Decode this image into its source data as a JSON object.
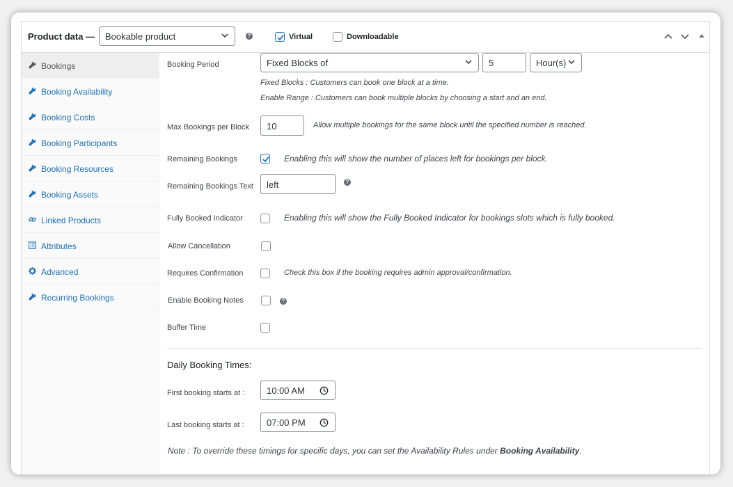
{
  "header": {
    "title": "Product data —",
    "product_type": "Bookable product",
    "virtual_label": "Virtual",
    "virtual_checked": true,
    "downloadable_label": "Downloadable",
    "downloadable_checked": false
  },
  "sidebar": {
    "items": [
      {
        "label": "Bookings",
        "icon": "wrench-icon",
        "active": true
      },
      {
        "label": "Booking Availability",
        "icon": "wrench-icon"
      },
      {
        "label": "Booking Costs",
        "icon": "wrench-icon"
      },
      {
        "label": "Booking Participants",
        "icon": "wrench-icon"
      },
      {
        "label": "Booking Resources",
        "icon": "wrench-icon"
      },
      {
        "label": "Booking Assets",
        "icon": "wrench-icon"
      },
      {
        "label": "Linked Products",
        "icon": "link-icon"
      },
      {
        "label": "Attributes",
        "icon": "list-icon"
      },
      {
        "label": "Advanced",
        "icon": "gear-icon"
      },
      {
        "label": "Recurring Bookings",
        "icon": "wrench-icon"
      }
    ]
  },
  "main": {
    "booking_period": {
      "label": "Booking Period",
      "type_value": "Fixed Blocks of",
      "count_value": "5",
      "unit_value": "Hour(s)",
      "desc1": "Fixed Blocks : Customers can book one block at a time.",
      "desc2": "Enable Range : Customers can book multiple blocks by choosing a start and an end."
    },
    "max_bookings": {
      "label": "Max Bookings per Block",
      "value": "10",
      "desc": "Allow multiple bookings for the same block until the specified number is reached."
    },
    "remaining_bookings": {
      "label": "Remaining Bookings",
      "checked": true,
      "desc": "Enabling this will show the number of places left for bookings per block."
    },
    "remaining_text": {
      "label": "Remaining Bookings Text",
      "value": "left"
    },
    "fully_booked": {
      "label": "Fully Booked Indicator",
      "checked": false,
      "desc": "Enabling this will show the Fully Booked Indicator for bookings slots which is fully booked."
    },
    "allow_cancellation": {
      "label": "Allow Cancellation",
      "checked": false
    },
    "requires_confirmation": {
      "label": "Requires Confirmation",
      "checked": false,
      "desc": "Check this box if the booking requires admin approval/confirmation."
    },
    "booking_notes": {
      "label": "Enable Booking Notes",
      "checked": false
    },
    "buffer_time": {
      "label": "Buffer Time",
      "checked": false
    },
    "daily_times": {
      "title": "Daily Booking Times:",
      "first_label": "First booking starts at :",
      "first_value": "10:00 AM",
      "last_label": "Last booking starts at :",
      "last_value": "07:00 PM",
      "note_prefix": "Note : To override these timings for specific days, you can set the Availability Rules under ",
      "note_bold": "Booking Availability",
      "note_suffix": "."
    }
  },
  "colors": {
    "accent": "#2271b1",
    "text": "#3c434a",
    "border": "#8c8f94"
  }
}
